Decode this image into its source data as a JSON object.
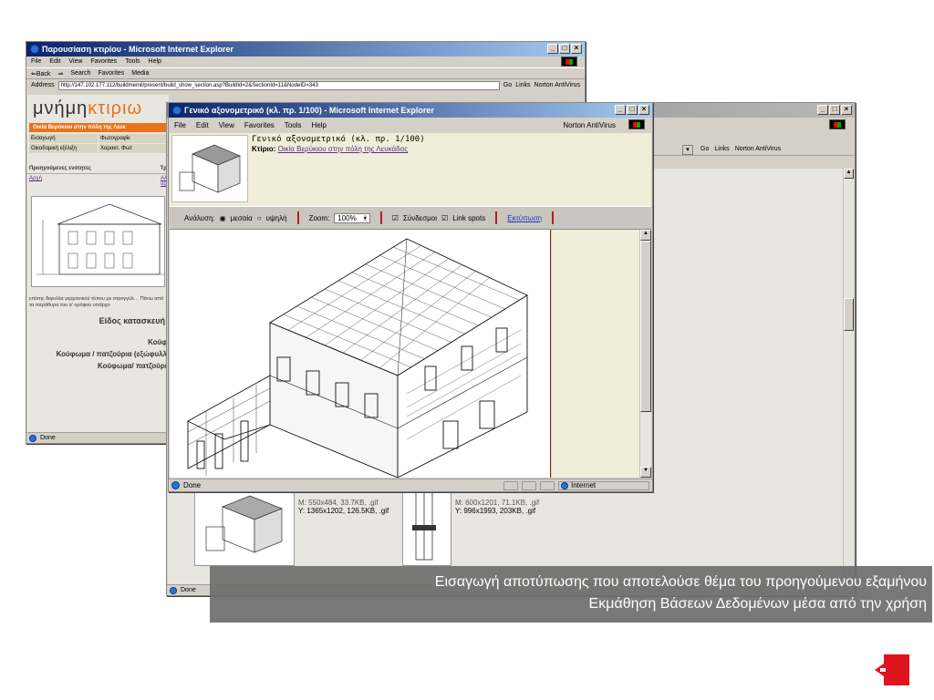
{
  "back_window": {
    "title": "Παρουσίαση κτιρίου - Microsoft Internet Explorer",
    "menu": [
      "File",
      "Edit",
      "View",
      "Favorites",
      "Tools",
      "Help"
    ],
    "toolbar": [
      "⇐Back",
      "⇒",
      "Search",
      "Favorites",
      "Media"
    ],
    "address_label": "Address",
    "address_value": "http://147.102.177.112/buildmemil/present/build_show_section.asp?BuildId=2&SectionId=11&NodeID=343",
    "go_label": "Go",
    "links_label": "Links",
    "norton_label": "Norton AntiVirus",
    "site_logo_a": "μνήμη",
    "site_logo_b": "κτιριω",
    "orange_bar": "Οικία Βερύκιου στην πόλη της Λευκ",
    "nav_col1": [
      "Εισαγωγή",
      "Οικοδομική εξέλιξη"
    ],
    "nav_col2": [
      "Φωτογραφίε",
      "Χαρακτ. Φωτ"
    ],
    "section_heading": "Προηγούμενες ενότητες",
    "section_heading2": "Τρ",
    "section_link": "Αρχή",
    "section_link2": "Αλ",
    "section_link3": "όρ",
    "desc_text": "επίσης διφυλλα γερμανικού τύπου με στρογγύλ… Πάνω από τα παράθυρα του α' ορόφου υπάρχο",
    "heading_a": "Είδος κατασκευή",
    "heading_b": "Κούφ",
    "heading_c": "Κούφωμα / πατζούρια (εξώφυλλ",
    "heading_d": "Κούφωμα/ πατζούρι",
    "status": "Done"
  },
  "mid_window": {
    "go_label": "Go",
    "links_label": "Links",
    "norton_label": "Norton AntiVirus",
    "thumb1_m": "M: 550x484, 33.7KB, .gif",
    "thumb1_y": "Y: 1365x1202, 126.5KB, .gif",
    "thumb2_m": "M: 600x1201, 71.1KB, .gif",
    "thumb2_y": "Y: 996x1993, 203KB, .gif",
    "status": "Done"
  },
  "front_window": {
    "title": "Γενικό αξονομετρικό (κλ. πρ. 1/100) - Microsoft Internet Explorer",
    "menu": [
      "File",
      "Edit",
      "View",
      "Favorites",
      "Tools",
      "Help"
    ],
    "norton_label": "Norton AntiVirus",
    "header_title": "Γενικό αξονομετρικό (κλ. πρ. 1/100)",
    "building_label": "Κτίριο:",
    "building_link": "Οικία Βερύκιου στην πόλη της Λευκάδας",
    "resolution_label": "Ανάλυση:",
    "res_medium": "μεσαία",
    "res_high": "υψηλή",
    "zoom_label": "Zoom:",
    "zoom_value": "100%",
    "links_chk": "Σύνδεσμοι",
    "spots_chk": "Link spots",
    "print_link": "Εκτύπωση",
    "status": "Done",
    "zone": "Internet"
  },
  "caption": {
    "line1": "Εισαγωγή αποτύπωσης που αποτελούσε θέμα του προηγούμενου εξαμήνου",
    "line2": "Εκμάθηση Βάσεων Δεδομένων μέσα από την χρήση"
  },
  "colors": {
    "accent_red": "#e0141e",
    "orange": "#e8731a",
    "ie_blue": "#0a246a"
  }
}
